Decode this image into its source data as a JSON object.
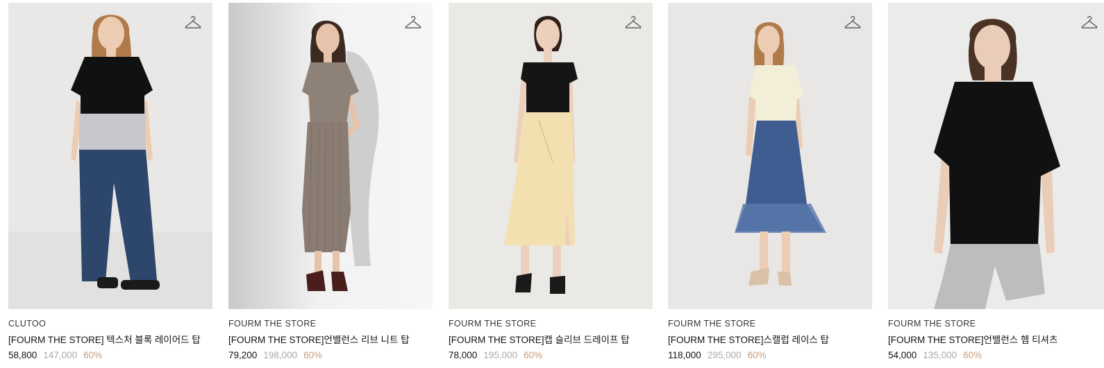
{
  "products": [
    {
      "brand": "CLUTOO",
      "name": "[FOURM THE STORE] 텍스처 블록 레이어드 탑",
      "price": "58,800",
      "original_price": "147,000",
      "discount": "60%",
      "image_icon": "model-photo",
      "colors": {
        "bg": "#e9e8e6",
        "top": "#111111",
        "layer": "#c7c8cd",
        "bottom": "#2d466c",
        "shoes": "#1a1a1a",
        "hair": "#b07a4a"
      }
    },
    {
      "brand": "FOURM THE STORE",
      "name": "[FOURM THE STORE]언밸런스 리브 니트 탑",
      "price": "79,200",
      "original_price": "198,000",
      "discount": "60%",
      "image_icon": "model-photo",
      "colors": {
        "bg": "#f0f0f0",
        "top": "#8e8178",
        "layer": "#8e8178",
        "bottom": "#8a7c72",
        "shoes": "#4a1e1a",
        "hair": "#3b2a20"
      }
    },
    {
      "brand": "FOURM THE STORE",
      "name": "[FOURM THE STORE]캡 슬리브 드레이프 탑",
      "price": "78,000",
      "original_price": "195,000",
      "discount": "60%",
      "image_icon": "model-photo",
      "colors": {
        "bg": "#ebe9e6",
        "top": "#151515",
        "layer": "#151515",
        "bottom": "#f2e0b0",
        "shoes": "#1a1a1a",
        "hair": "#2e2019"
      }
    },
    {
      "brand": "FOURM THE STORE",
      "name": "[FOURM THE STORE]스캘럽 레이스 탑",
      "price": "118,000",
      "original_price": "295,000",
      "discount": "60%",
      "image_icon": "model-photo",
      "colors": {
        "bg": "#e8e7e5",
        "top": "#f2eed8",
        "layer": "#f2eed8",
        "bottom": "#3f5d91",
        "shoes": "#d9c2a5",
        "hair": "#b07a4a"
      }
    },
    {
      "brand": "FOURM THE STORE",
      "name": "[FOURM THE STORE]언밸런스 헴 티셔츠",
      "price": "54,000",
      "original_price": "135,000",
      "discount": "60%",
      "image_icon": "model-photo",
      "colors": {
        "bg": "#ebebea",
        "top": "#111111",
        "layer": "#111111",
        "bottom": "#bdbdbb",
        "shoes": "#bdbdbb",
        "hair": "#4a3325"
      }
    }
  ],
  "icons": {
    "wishlist": "hanger-icon"
  }
}
